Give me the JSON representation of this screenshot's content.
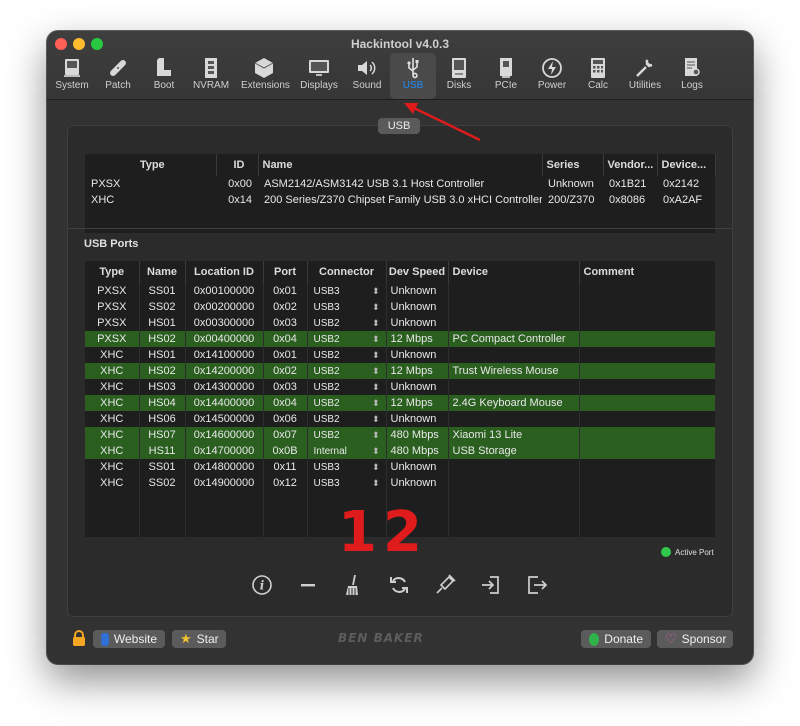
{
  "window": {
    "title": "Hackintool v4.0.3"
  },
  "toolbar": {
    "items": [
      {
        "label": "System",
        "icon": "system-icon"
      },
      {
        "label": "Patch",
        "icon": "patch-icon"
      },
      {
        "label": "Boot",
        "icon": "boot-icon"
      },
      {
        "label": "NVRAM",
        "icon": "nvram-icon"
      },
      {
        "label": "Extensions",
        "icon": "extensions-icon"
      },
      {
        "label": "Displays",
        "icon": "displays-icon"
      },
      {
        "label": "Sound",
        "icon": "sound-icon"
      },
      {
        "label": "USB",
        "icon": "usb-icon",
        "active": true
      },
      {
        "label": "Disks",
        "icon": "disks-icon"
      },
      {
        "label": "PCIe",
        "icon": "pcie-icon"
      },
      {
        "label": "Power",
        "icon": "power-icon"
      },
      {
        "label": "Calc",
        "icon": "calc-icon"
      },
      {
        "label": "Utilities",
        "icon": "utilities-icon"
      },
      {
        "label": "Logs",
        "icon": "logs-icon"
      }
    ]
  },
  "section_badge": "USB",
  "controllers": {
    "headers": [
      "Type",
      "ID",
      "Name",
      "Series",
      "Vendor...",
      "Device..."
    ],
    "rows": [
      [
        "PXSX",
        "0x00",
        "ASM2142/ASM3142 USB 3.1 Host Controller",
        "Unknown",
        "0x1B21",
        "0x2142"
      ],
      [
        "XHC",
        "0x14",
        "200 Series/Z370 Chipset Family USB 3.0 xHCI Controller",
        "200/Z370",
        "0x8086",
        "0xA2AF"
      ]
    ]
  },
  "usb_ports": {
    "label": "USB Ports",
    "headers": [
      "Type",
      "Name",
      "Location ID",
      "Port",
      "Connector",
      "Dev Speed",
      "Device",
      "Comment"
    ],
    "rows": [
      {
        "type": "PXSX",
        "name": "SS01",
        "location": "0x00100000",
        "port": "0x01",
        "connector": "USB3",
        "speed": "Unknown",
        "device": "",
        "comment": "",
        "active": false
      },
      {
        "type": "PXSX",
        "name": "SS02",
        "location": "0x00200000",
        "port": "0x02",
        "connector": "USB3",
        "speed": "Unknown",
        "device": "",
        "comment": "",
        "active": false
      },
      {
        "type": "PXSX",
        "name": "HS01",
        "location": "0x00300000",
        "port": "0x03",
        "connector": "USB2",
        "speed": "Unknown",
        "device": "",
        "comment": "",
        "active": false
      },
      {
        "type": "PXSX",
        "name": "HS02",
        "location": "0x00400000",
        "port": "0x04",
        "connector": "USB2",
        "speed": "12 Mbps",
        "device": "PC Compact Controller",
        "comment": "",
        "active": true
      },
      {
        "type": "XHC",
        "name": "HS01",
        "location": "0x14100000",
        "port": "0x01",
        "connector": "USB2",
        "speed": "Unknown",
        "device": "",
        "comment": "",
        "active": false
      },
      {
        "type": "XHC",
        "name": "HS02",
        "location": "0x14200000",
        "port": "0x02",
        "connector": "USB2",
        "speed": "12 Mbps",
        "device": "Trust Wireless Mouse",
        "comment": "",
        "active": true
      },
      {
        "type": "XHC",
        "name": "HS03",
        "location": "0x14300000",
        "port": "0x03",
        "connector": "USB2",
        "speed": "Unknown",
        "device": "",
        "comment": "",
        "active": false
      },
      {
        "type": "XHC",
        "name": "HS04",
        "location": "0x14400000",
        "port": "0x04",
        "connector": "USB2",
        "speed": "12 Mbps",
        "device": "2.4G Keyboard Mouse",
        "comment": "",
        "active": true
      },
      {
        "type": "XHC",
        "name": "HS06",
        "location": "0x14500000",
        "port": "0x06",
        "connector": "USB2",
        "speed": "Unknown",
        "device": "",
        "comment": "",
        "active": false
      },
      {
        "type": "XHC",
        "name": "HS07",
        "location": "0x14600000",
        "port": "0x07",
        "connector": "USB2",
        "speed": "480 Mbps",
        "device": "Xiaomi 13 Lite",
        "comment": "",
        "active": true
      },
      {
        "type": "XHC",
        "name": "HS11",
        "location": "0x14700000",
        "port": "0x0B",
        "connector": "Internal",
        "speed": "480 Mbps",
        "device": "USB Storage",
        "comment": "",
        "active": true
      },
      {
        "type": "XHC",
        "name": "SS01",
        "location": "0x14800000",
        "port": "0x11",
        "connector": "USB3",
        "speed": "Unknown",
        "device": "",
        "comment": "",
        "active": false
      },
      {
        "type": "XHC",
        "name": "SS02",
        "location": "0x14900000",
        "port": "0x12",
        "connector": "USB3",
        "speed": "Unknown",
        "device": "",
        "comment": "",
        "active": false
      }
    ],
    "active_row_color": "#2a5f1f"
  },
  "legend": {
    "label": "Active Port",
    "color": "#30c94a"
  },
  "actions": [
    "info-icon",
    "remove-icon",
    "clean-icon",
    "refresh-icon",
    "inject-icon",
    "import-icon",
    "export-icon"
  ],
  "annotation": {
    "number": "12",
    "color": "#e01b1b"
  },
  "footer": {
    "website": "Website",
    "star": "Star",
    "brand": "BEN BAKER",
    "donate": "Donate",
    "sponsor": "Sponsor"
  },
  "colors": {
    "accent": "#1e8dff",
    "window_bg": "#323232"
  }
}
